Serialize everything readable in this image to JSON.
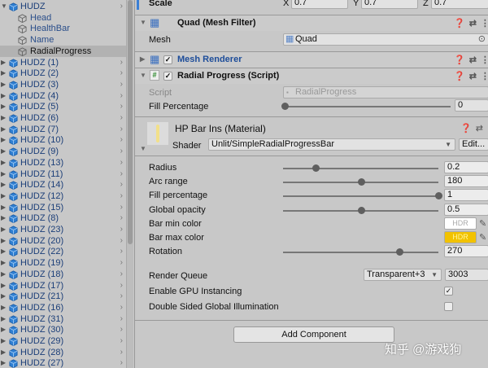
{
  "hierarchy": {
    "root": "HUDZ",
    "children": [
      "Head",
      "HealthBar",
      "Name",
      "RadialProgress"
    ],
    "selected": "RadialProgress",
    "siblings": [
      "HUDZ (1)",
      "HUDZ (2)",
      "HUDZ (3)",
      "HUDZ (4)",
      "HUDZ (5)",
      "HUDZ (6)",
      "HUDZ (7)",
      "HUDZ (10)",
      "HUDZ (9)",
      "HUDZ (13)",
      "HUDZ (11)",
      "HUDZ (14)",
      "HUDZ (12)",
      "HUDZ (15)",
      "HUDZ (8)",
      "HUDZ (23)",
      "HUDZ (20)",
      "HUDZ (22)",
      "HUDZ (19)",
      "HUDZ (18)",
      "HUDZ (17)",
      "HUDZ (21)",
      "HUDZ (16)",
      "HUDZ (31)",
      "HUDZ (30)",
      "HUDZ (29)",
      "HUDZ (28)",
      "HUDZ (27)"
    ]
  },
  "transform": {
    "scale_label": "Scale",
    "x_label": "X",
    "x": "0.7",
    "y_label": "Y",
    "y": "0.7",
    "z_label": "Z",
    "z": "0.7"
  },
  "mesh_filter": {
    "title": "Quad (Mesh Filter)",
    "mesh_label": "Mesh",
    "mesh_value": "Quad"
  },
  "mesh_renderer": {
    "title": "Mesh Renderer",
    "enabled": true
  },
  "radial_script": {
    "title": "Radial Progress (Script)",
    "enabled": true,
    "script_label": "Script",
    "script_value": "RadialProgress",
    "fill_label": "Fill Percentage",
    "fill_value": "0",
    "fill_fraction": 0
  },
  "material": {
    "title": "HP Bar Ins (Material)",
    "shader_label": "Shader",
    "shader_value": "Unlit/SimpleRadialProgressBar",
    "edit_label": "Edit..."
  },
  "properties": [
    {
      "label": "Radius",
      "value": "0.2",
      "fraction": 0.21
    },
    {
      "label": "Arc range",
      "value": "180",
      "fraction": 0.5
    },
    {
      "label": "Fill percentage",
      "value": "1",
      "fraction": 1
    },
    {
      "label": "Global opacity",
      "value": "0.5",
      "fraction": 0.5
    },
    {
      "label": "Bar min color",
      "color_text": "HDR",
      "color": "#ffffff"
    },
    {
      "label": "Bar max color",
      "color_text": "HDR",
      "color": "#f2c200"
    },
    {
      "label": "Rotation",
      "value": "270",
      "fraction": 0.75
    }
  ],
  "render_queue": {
    "label": "Render Queue",
    "option": "Transparent+3",
    "value": "3003"
  },
  "gpu_instancing": {
    "label": "Enable GPU Instancing",
    "checked": true
  },
  "double_sided": {
    "label": "Double Sided Global Illumination",
    "checked": false
  },
  "add_component": "Add Component",
  "watermark": "知乎 @游戏狗"
}
